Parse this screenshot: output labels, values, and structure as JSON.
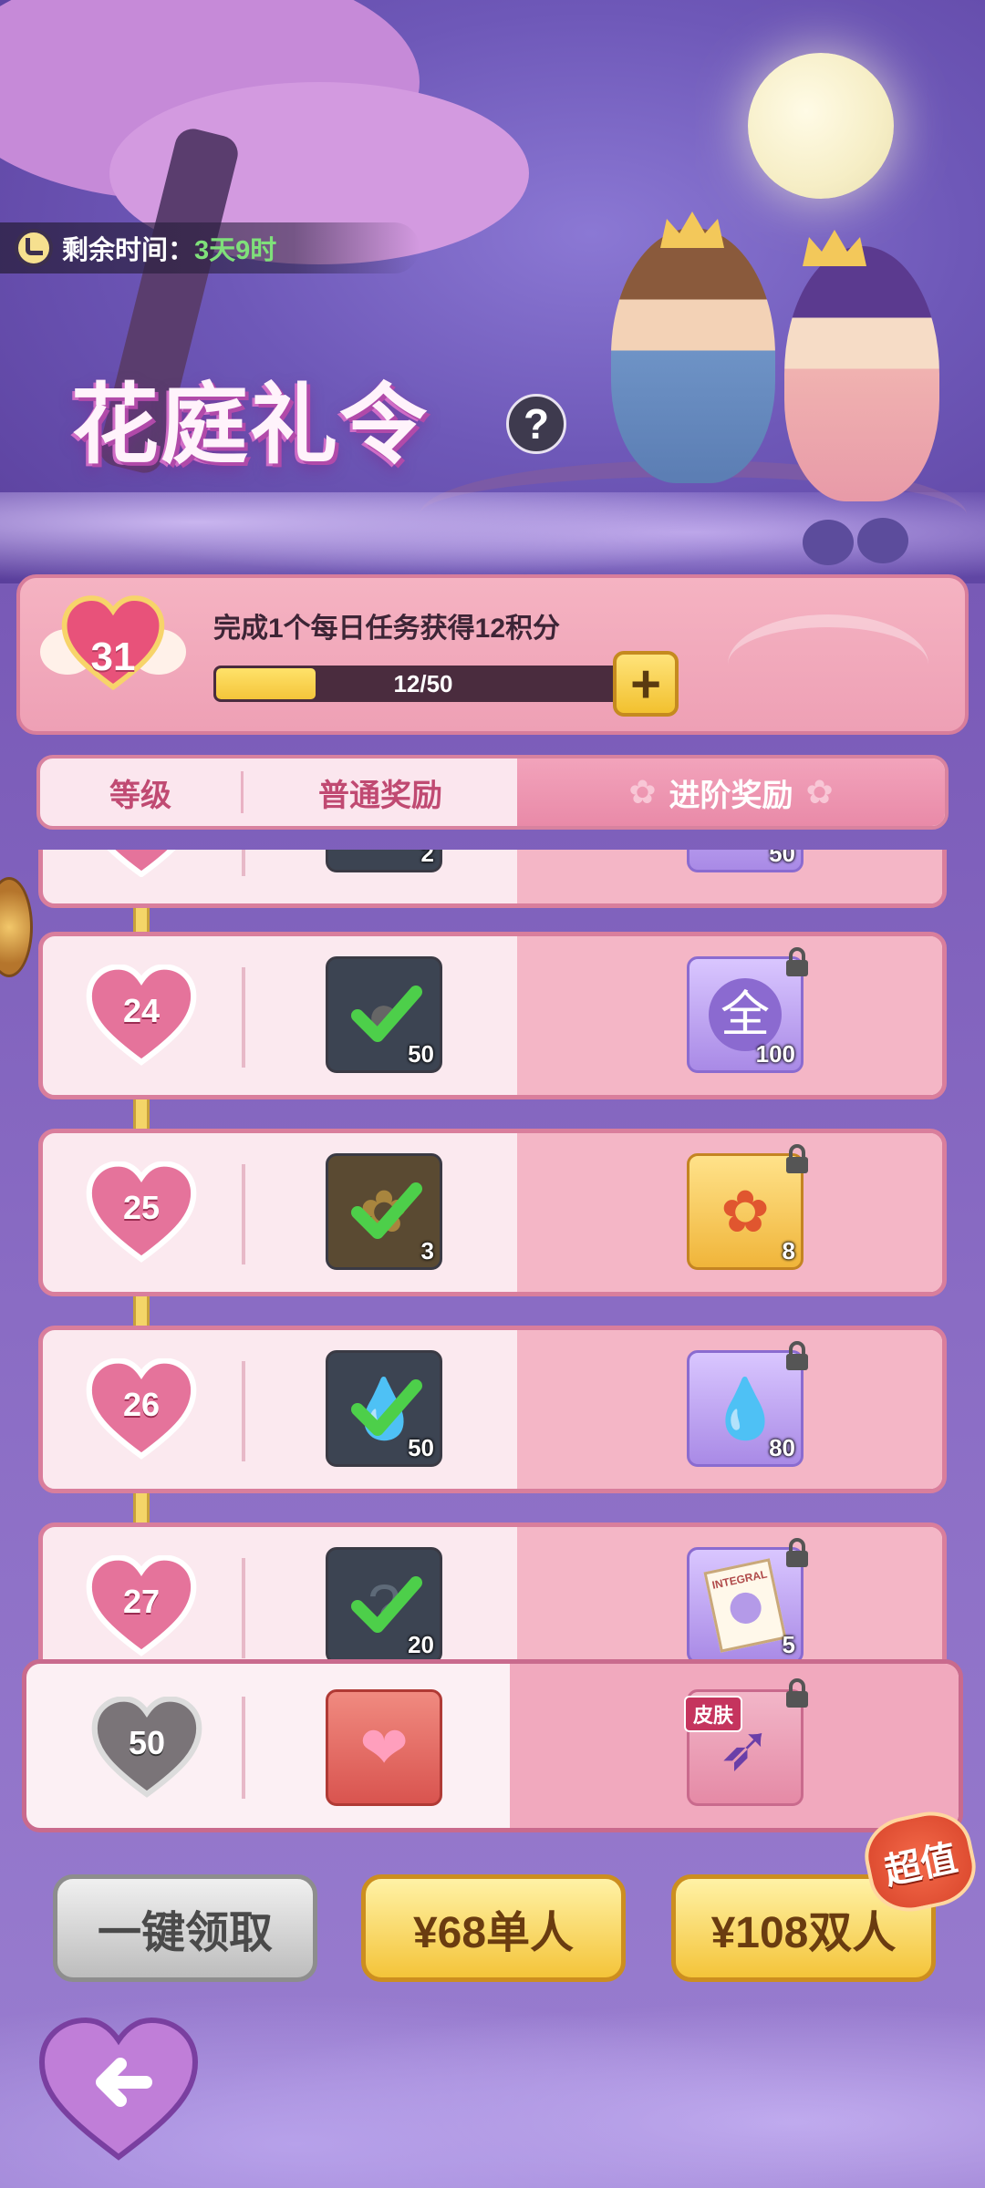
{
  "timer": {
    "label": "剩余时间：",
    "value": "3天9时"
  },
  "logo": {
    "title": "花庭礼令",
    "help": "?"
  },
  "points": {
    "level": "31",
    "task_text": "完成1个每日任务获得12积分",
    "progress_text": "12/50",
    "progress_fraction": 0.24,
    "plus": "+"
  },
  "tabs": {
    "level": "等级",
    "normal": "普通奖励",
    "advanced": "进阶奖励"
  },
  "rows": [
    {
      "level": "",
      "normal_qty": "2",
      "adv_qty": "50"
    },
    {
      "level": "24",
      "normal_qty": "50",
      "adv_qty": "100",
      "adv_glyph": "全"
    },
    {
      "level": "25",
      "normal_qty": "3",
      "adv_qty": "8"
    },
    {
      "level": "26",
      "normal_qty": "50",
      "adv_qty": "80"
    },
    {
      "level": "27",
      "normal_qty": "20",
      "adv_qty": "5",
      "adv_doc": "INTEGRAL"
    }
  ],
  "final_row": {
    "level": "50",
    "skin_tag": "皮肤"
  },
  "buttons": {
    "claim_all": "一键领取",
    "price_single": "¥68单人",
    "price_double": "¥108双人",
    "value_badge": "超值"
  },
  "colors": {
    "accent_pink": "#d97e9c",
    "gold": "#f4c43a",
    "timer_green": "#7fe07a"
  }
}
